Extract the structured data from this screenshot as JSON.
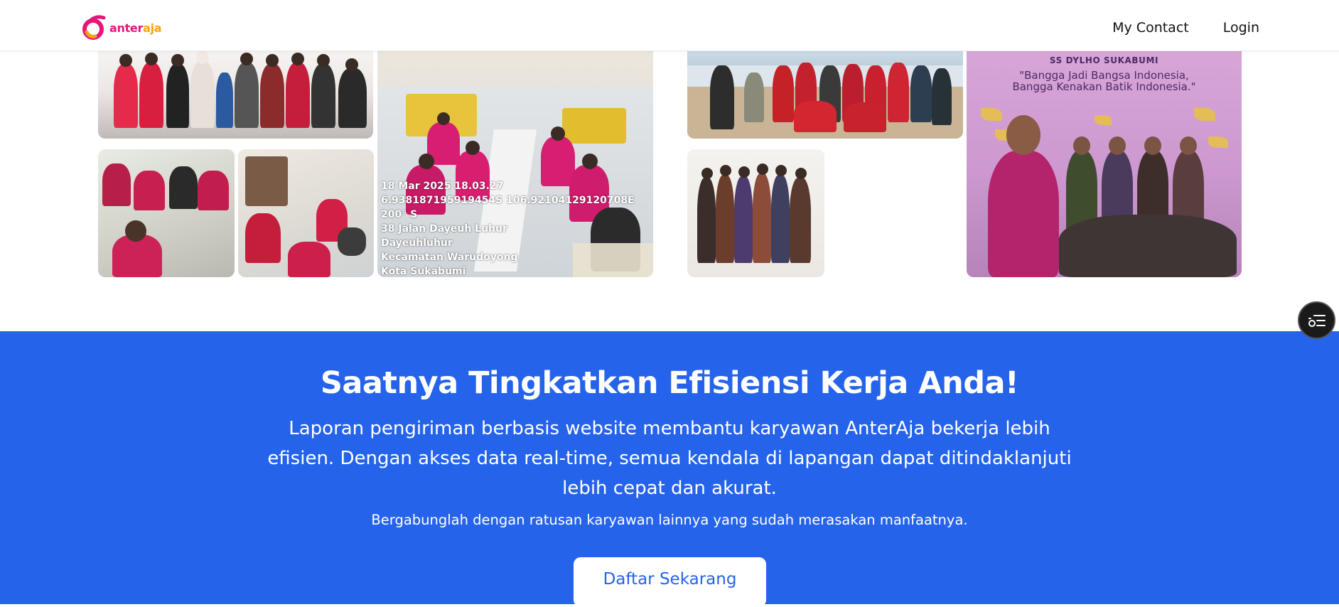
{
  "header": {
    "logo_text_pink": "anter",
    "logo_text_orange": "aja",
    "nav": [
      {
        "label": "My Contact"
      },
      {
        "label": "Login"
      }
    ]
  },
  "gallery": {
    "geotag": {
      "line1": "18 Mar 2025 18.03.27",
      "line2": "6.938187195919454S 106.92104129120708E",
      "line3": "200° S",
      "line4": "38 Jalan Dayeuh Luhur",
      "line5": "Dayeuhluhur",
      "line6": "Kecamatan Warudoyong",
      "line7": "Kota Sukabumi"
    },
    "poster": {
      "org": "SS DYLHO SUKABUMI",
      "quote_line1": "\"Bangga Jadi Bangsa Indonesia,",
      "quote_line2": "Bangga Kenakan Batik Indonesia.\""
    }
  },
  "cta": {
    "title": "Saatnya Tingkatkan Efisiensi Kerja Anda!",
    "description": "Laporan pengiriman berbasis website membantu karyawan AnterAja bekerja lebih efisien. Dengan akses data real-time, semua kendala di lapangan dapat ditindaklanjuti lebih cepat dan akurat.",
    "subtext": "Bergabunglah dengan ratusan karyawan lainnya yang sudah merasakan manfaatnya.",
    "button_label": "Daftar Sekarang"
  },
  "colors": {
    "brand_pink": "#e6157a",
    "brand_orange": "#f4a416",
    "cta_blue": "#2563eb"
  },
  "icons": {
    "floating": "list-settings-icon"
  }
}
